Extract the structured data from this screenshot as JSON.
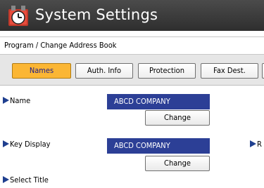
{
  "window": {
    "title": "System Settings",
    "icon": "system-settings-clock-icon"
  },
  "breadcrumb": "Program / Change Address Book",
  "tabs": [
    {
      "label": "Names",
      "active": true
    },
    {
      "label": "Auth. Info",
      "active": false
    },
    {
      "label": "Protection",
      "active": false
    },
    {
      "label": "Fax Dest.",
      "active": false
    }
  ],
  "fields": {
    "name": {
      "label": "Name",
      "value": "ABCD COMPANY",
      "button": "Change"
    },
    "key_display": {
      "label": "Key Display",
      "value": "ABCD COMPANY",
      "button": "Change"
    },
    "select_title": {
      "label": "Select Title"
    }
  },
  "right_partial_label": "R",
  "colors": {
    "active_tab": "#fbb634",
    "value_box": "#2c3f96",
    "title_bar": "#3a3a3a"
  }
}
